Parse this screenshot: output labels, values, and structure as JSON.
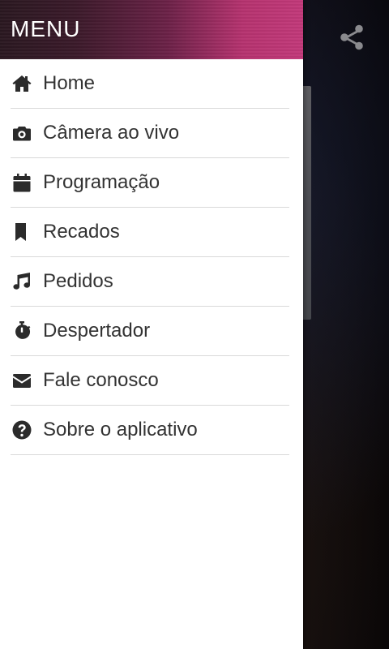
{
  "drawer": {
    "title": "MENU",
    "items": [
      {
        "label": "Home",
        "icon": "home-icon"
      },
      {
        "label": "Câmera ao vivo",
        "icon": "camera-icon"
      },
      {
        "label": "Programação",
        "icon": "calendar-icon"
      },
      {
        "label": "Recados",
        "icon": "bookmark-icon"
      },
      {
        "label": "Pedidos",
        "icon": "music-note-icon"
      },
      {
        "label": "Despertador",
        "icon": "stopwatch-icon"
      },
      {
        "label": "Fale conosco",
        "icon": "envelope-icon"
      },
      {
        "label": "Sobre o aplicativo",
        "icon": "question-circle-icon"
      }
    ]
  },
  "background": {
    "share_icon": "share-icon"
  },
  "colors": {
    "header_gradient_start": "#2a1820",
    "header_gradient_end": "#c2397a",
    "text": "#333333",
    "divider": "#d9d9d9"
  }
}
